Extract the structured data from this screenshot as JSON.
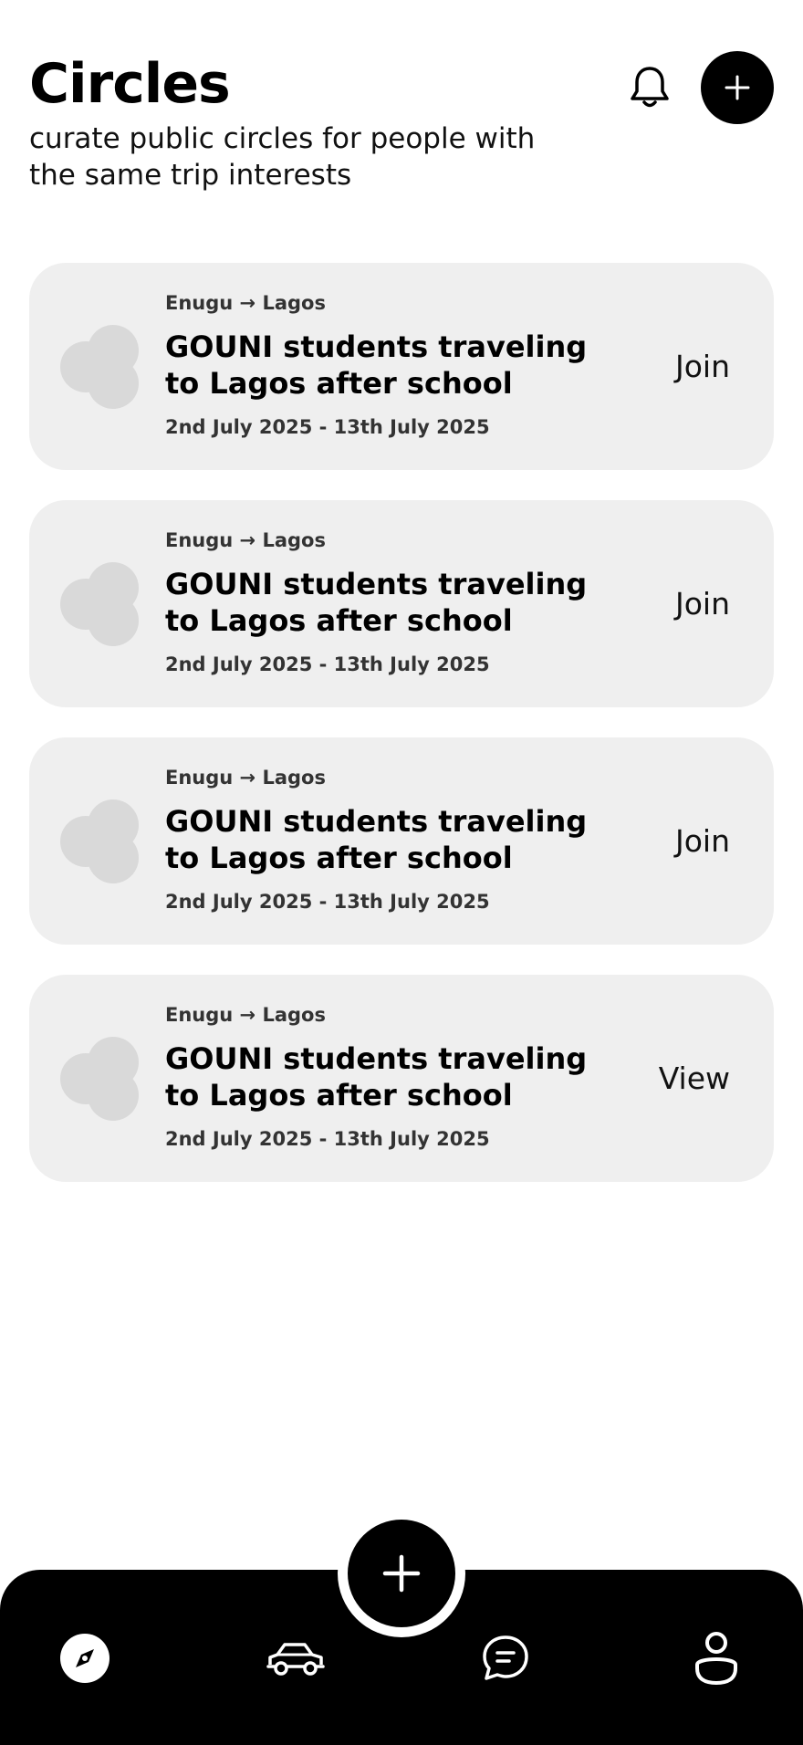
{
  "header": {
    "title": "Circles",
    "subtitle": "curate public circles for people with the same trip interests"
  },
  "circles": [
    {
      "route": "Enugu → Lagos",
      "title": "GOUNI students traveling to Lagos after school",
      "dates": "2nd July 2025 - 13th July 2025",
      "action": "Join"
    },
    {
      "route": "Enugu → Lagos",
      "title": "GOUNI students traveling to Lagos after school",
      "dates": "2nd July 2025 - 13th July 2025",
      "action": "Join"
    },
    {
      "route": "Enugu → Lagos",
      "title": "GOUNI students traveling to Lagos after school",
      "dates": "2nd July 2025 - 13th July 2025",
      "action": "Join"
    },
    {
      "route": "Enugu → Lagos",
      "title": "GOUNI students traveling to Lagos after school",
      "dates": "2nd July 2025 - 13th July 2025",
      "action": "View"
    }
  ],
  "icons": {
    "bell": "bell-icon",
    "add": "plus-icon",
    "explore": "compass-icon",
    "rides": "car-icon",
    "messages": "chat-icon",
    "profile": "user-icon"
  },
  "colors": {
    "background": "#ffffff",
    "card": "#efefef",
    "avatar": "#d9d9d9",
    "accent": "#000000"
  }
}
